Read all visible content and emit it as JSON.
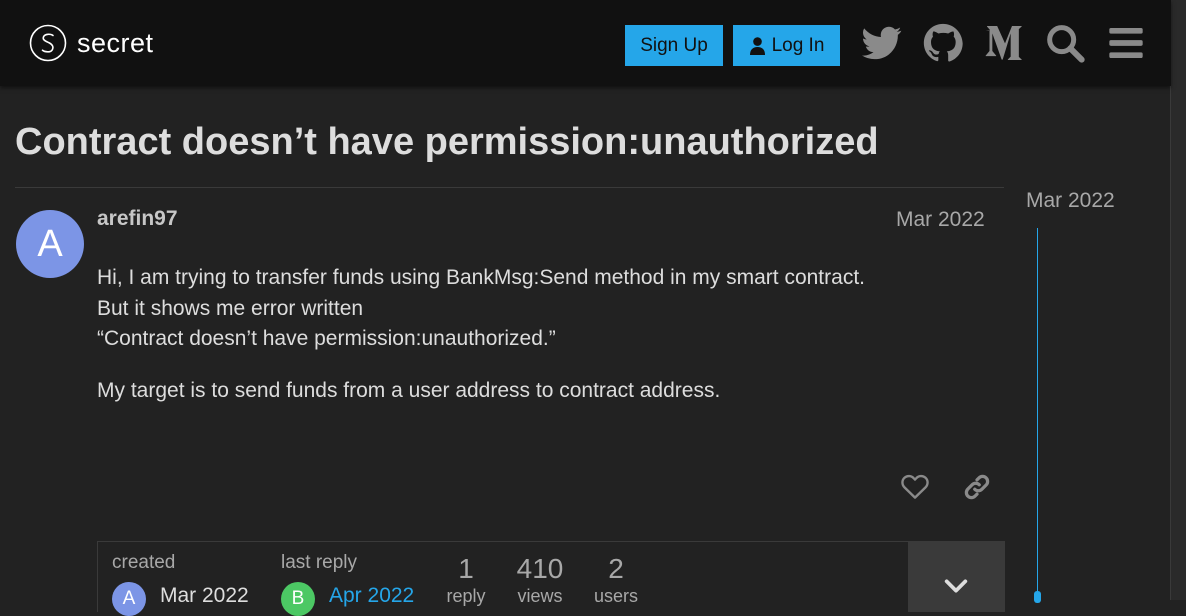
{
  "header": {
    "logo_text": "secret",
    "signup_label": "Sign Up",
    "login_label": "Log In",
    "icons": [
      "twitter-icon",
      "github-icon",
      "medium-icon",
      "search-icon",
      "hamburger-menu-icon"
    ],
    "accent_color": "#25a6e9"
  },
  "topic": {
    "title": "Contract doesn’t have permission:unauthorized"
  },
  "post": {
    "avatar_letter": "A",
    "avatar_color": "#7c95e6",
    "username": "arefin97",
    "date": "Mar 2022",
    "paragraphs": [
      [
        "Hi, I am trying to transfer funds using BankMsg:Send method in my smart contract.",
        "But it shows me error written",
        "“Contract doesn’t have permission:unauthorized.”"
      ],
      [
        "My target is to send funds from a user address to contract address."
      ]
    ]
  },
  "summary": {
    "created_label": "created",
    "created_avatar": "A",
    "created_date": "Mar 2022",
    "last_reply_label": "last reply",
    "last_reply_avatar": "B",
    "last_reply_avatar_color": "#4cc864",
    "last_reply_date": "Apr 2022",
    "replies": "1",
    "replies_label": "reply",
    "views": "410",
    "views_label": "views",
    "users": "2",
    "users_label": "users"
  },
  "timeline": {
    "date": "Mar 2022"
  }
}
